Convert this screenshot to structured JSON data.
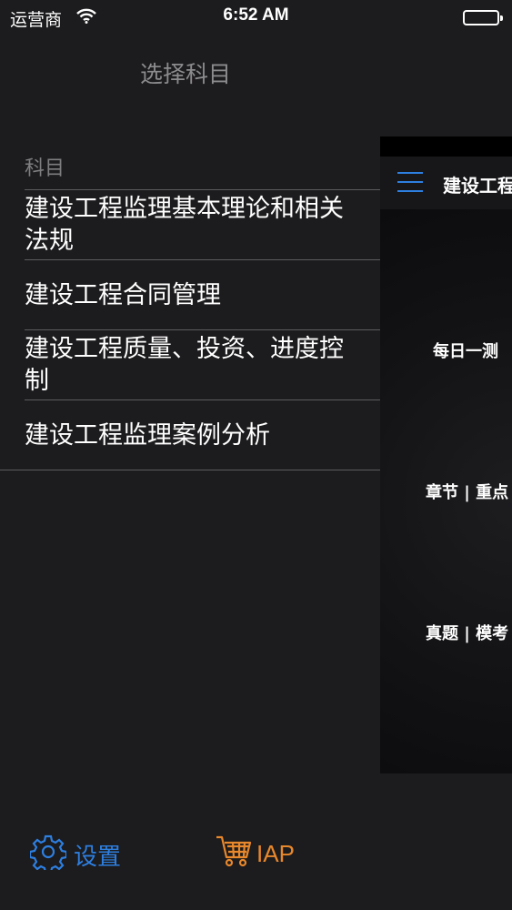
{
  "status": {
    "carrier": "运营商",
    "time": "6:52 AM"
  },
  "menu": {
    "title": "选择科目",
    "section_header": "科目",
    "items": [
      {
        "label": "建设工程监理基本理论和相关法规"
      },
      {
        "label": "建设工程合同管理"
      },
      {
        "label": "建设工程质量、投资、进度控制"
      },
      {
        "label": "建设工程监理案例分析"
      }
    ]
  },
  "main": {
    "nav_title": "建设工程",
    "labels": [
      "每日一测",
      "章节 | 重点",
      "真题 | 模考"
    ]
  },
  "toolbar": {
    "settings_label": "设置",
    "iap_label": "IAP"
  },
  "colors": {
    "accent_blue": "#2d7fe0",
    "accent_orange": "#e8882c",
    "background": "#1c1b1d"
  }
}
